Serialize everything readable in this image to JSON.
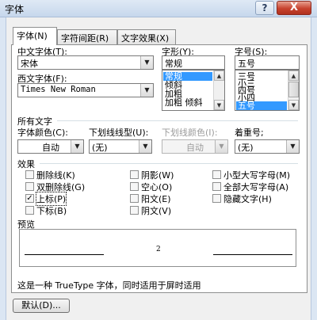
{
  "window": {
    "title": "字体",
    "help_label": "?",
    "close_label": "X"
  },
  "tabs": [
    {
      "label": "字体(N)"
    },
    {
      "label": "字符间距(R)"
    },
    {
      "label": "文字效果(X)"
    }
  ],
  "chinese_font": {
    "label": "中文字体(T):",
    "value": "宋体"
  },
  "western_font": {
    "label": "西文字体(F):",
    "value": "Times New Roman"
  },
  "style": {
    "label": "字形(Y):",
    "value": "常规",
    "options": [
      "常规",
      "倾斜",
      "加粗",
      "加粗 倾斜"
    ],
    "selected": "常规"
  },
  "size": {
    "label": "字号(S):",
    "value": "五号",
    "options": [
      "三号",
      "小三",
      "四号",
      "小四",
      "五号"
    ],
    "selected": "五号"
  },
  "all_text": {
    "heading": "所有文字",
    "font_color": {
      "label": "字体颜色(C):",
      "value": "自动"
    },
    "underline": {
      "label": "下划线线型(U):",
      "value": "(无)"
    },
    "underline_color": {
      "label": "下划线颜色(I):",
      "value": "自动"
    },
    "emphasis": {
      "label": "着重号;",
      "value": "(无)"
    }
  },
  "effects": {
    "heading": "效果",
    "items": [
      {
        "label": "删除线(K)",
        "checked": false
      },
      {
        "label": "双删除线(G)",
        "checked": false
      },
      {
        "label": "上标(P)",
        "checked": true
      },
      {
        "label": "下标(B)",
        "checked": false
      },
      {
        "label": "阴影(W)",
        "checked": false
      },
      {
        "label": "空心(O)",
        "checked": false
      },
      {
        "label": "阳文(E)",
        "checked": false
      },
      {
        "label": "阴文(V)",
        "checked": false
      },
      {
        "label": "小型大写字母(M)",
        "checked": false
      },
      {
        "label": "全部大写字母(A)",
        "checked": false
      },
      {
        "label": "隐藏文字(H)",
        "checked": false
      }
    ]
  },
  "preview": {
    "heading": "预览",
    "sample_text": "2"
  },
  "footer": {
    "note": "这是一种 TrueType 字体，同时适用于屏时适用",
    "default_button": "默认(D)..."
  }
}
